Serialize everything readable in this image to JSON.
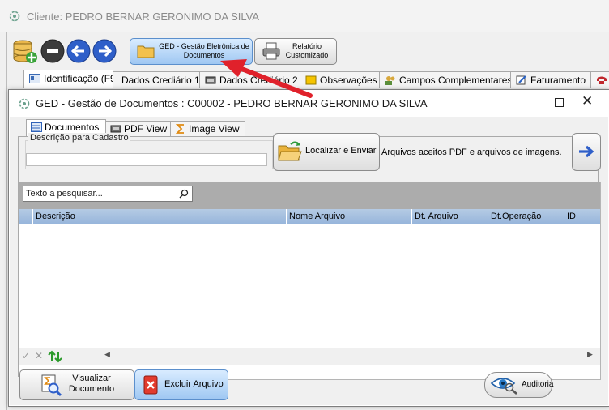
{
  "window": {
    "title": "Cliente: PEDRO BERNAR GERONIMO DA SILVA"
  },
  "toolbar": {
    "ged_label_1": "GED - Gestão Eletrônica de",
    "ged_label_2": "Documentos",
    "report_label_1": "Relatório",
    "report_label_2": "Customizado"
  },
  "main_tabs": [
    {
      "label": "Identificação (F9)"
    },
    {
      "label": "Dados Crediário 1"
    },
    {
      "label": "Dados Crediário 2"
    },
    {
      "label": "Observações"
    },
    {
      "label": "Campos Complementares"
    },
    {
      "label": "Faturamento"
    }
  ],
  "dialog": {
    "title": "GED - Gestão de Documentos : C00002 - PEDRO BERNAR GERONIMO DA SILVA",
    "tabs": [
      {
        "label": "Documentos"
      },
      {
        "label": "PDF View"
      },
      {
        "label": "Image View"
      }
    ],
    "description_label": "Descrição para Cadastro",
    "description_value": "",
    "locate_button": "Localizar e Enviar",
    "accepted_text": "Arquivos aceitos PDF e arquivos de imagens.",
    "search_placeholder": "Texto a pesquisar...",
    "columns": [
      "Descrição",
      "Nome Arquivo",
      "Dt. Arquivo",
      "Dt.Operação",
      "ID"
    ],
    "view_button_1": "Visualizar",
    "view_button_2": "Documento",
    "delete_button": "Excluir Arquivo",
    "audit_button": "Auditoria"
  },
  "colors": {
    "accent_blue": "#9fc7f2",
    "arrow_red": "#e0212b",
    "grid_header": "#97b5db"
  }
}
